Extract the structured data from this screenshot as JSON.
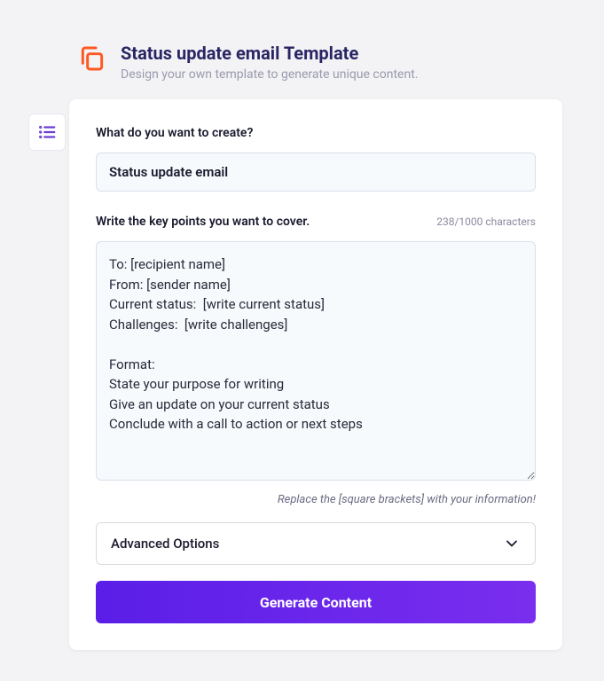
{
  "header": {
    "title": "Status update email Template",
    "subtitle": "Design your own template to generate unique content."
  },
  "form": {
    "create_label": "What do you want to create?",
    "create_value": "Status update email",
    "keypoints_label": "Write the key points you want to cover.",
    "char_count": "238/1000 characters",
    "keypoints_value": "To: [recipient name]\nFrom: [sender name]\nCurrent status:  [write current status]\nChallenges:  [write challenges]\n\nFormat:\nState your purpose for writing\nGive an update on your current status\nConclude with a call to action or next steps",
    "hint": "Replace the [square brackets] with your information!",
    "advanced_label": "Advanced Options",
    "generate_label": "Generate Content"
  }
}
